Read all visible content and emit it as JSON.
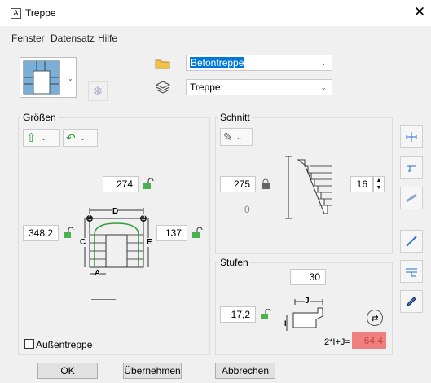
{
  "window": {
    "title": "Treppe",
    "app_icon_letter": "A"
  },
  "menu": [
    "Fenster",
    "Datensatz",
    "Hilfe"
  ],
  "top": {
    "material_value": "Betontreppe",
    "layer_value": "Treppe"
  },
  "groesse": {
    "label": "Größen",
    "top_value": "274",
    "left_value": "348,2",
    "right_value": "137",
    "diagram_labels": {
      "d": "D",
      "c": "C",
      "e": "E",
      "a": "A",
      "n1": "1",
      "n2": "2"
    }
  },
  "aussentreppe": {
    "label": "Außentreppe",
    "checked": false
  },
  "schnitt": {
    "label": "Schnitt",
    "height_value": "275",
    "zero_value": "0",
    "steps_value": "16"
  },
  "stufen": {
    "label": "Stufen",
    "tread_value": "30",
    "riser_value": "17,2",
    "formula_label": "2*I+J=",
    "formula_value": "64,4",
    "diagram_labels": {
      "j": "J",
      "i": "I"
    }
  },
  "buttons": {
    "ok": "OK",
    "apply": "Übernehmen",
    "cancel": "Abbrechen"
  },
  "colors": {
    "accent": "#0078d7",
    "formula_bg": "#f08080",
    "green": "#2e9e3a",
    "blue": "#3b6fd6"
  }
}
